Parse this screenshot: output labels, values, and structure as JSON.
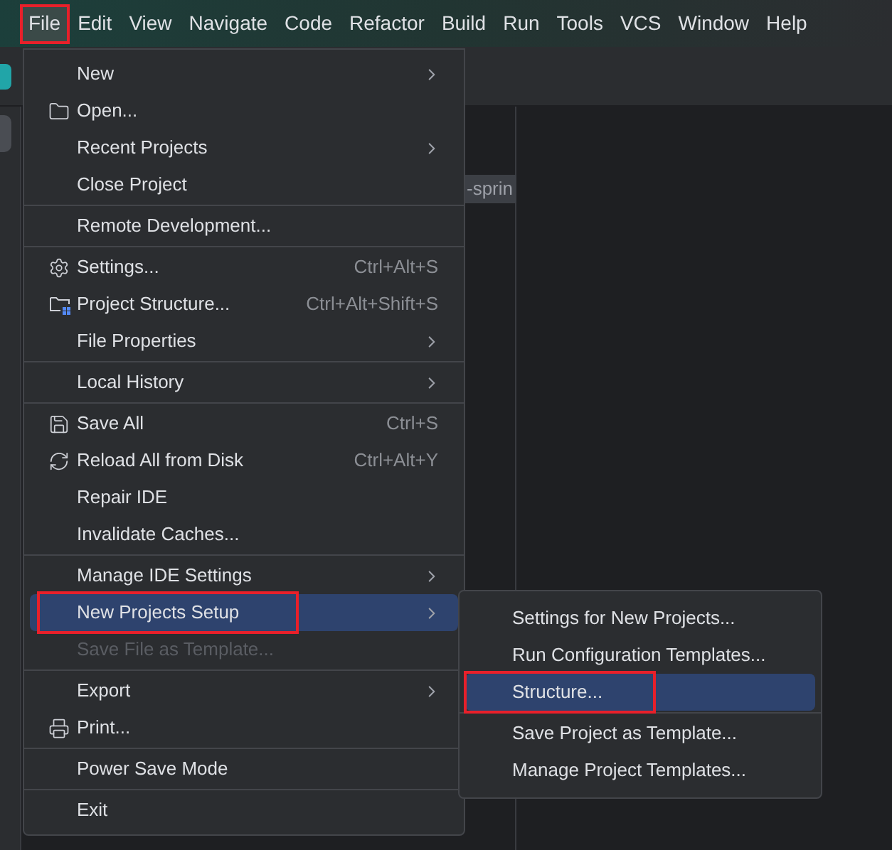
{
  "menu_bar": [
    {
      "label": "File",
      "selected": true,
      "annotated": true
    },
    {
      "label": "Edit",
      "selected": false,
      "annotated": false
    },
    {
      "label": "View",
      "selected": false,
      "annotated": false
    },
    {
      "label": "Navigate",
      "selected": false,
      "annotated": false
    },
    {
      "label": "Code",
      "selected": false,
      "annotated": false
    },
    {
      "label": "Refactor",
      "selected": false,
      "annotated": false
    },
    {
      "label": "Build",
      "selected": false,
      "annotated": false
    },
    {
      "label": "Run",
      "selected": false,
      "annotated": false
    },
    {
      "label": "Tools",
      "selected": false,
      "annotated": false
    },
    {
      "label": "VCS",
      "selected": false,
      "annotated": false
    },
    {
      "label": "Window",
      "selected": false,
      "annotated": false
    },
    {
      "label": "Help",
      "selected": false,
      "annotated": false
    }
  ],
  "editor": {
    "tab_fragment": "-sprin"
  },
  "file_menu": {
    "items": [
      {
        "kind": "item",
        "label": "New",
        "submenu": true,
        "selected": false,
        "disabled": false,
        "annotated": false
      },
      {
        "kind": "item",
        "label": "Open...",
        "submenu": false,
        "selected": false,
        "disabled": false,
        "annotated": false
      },
      {
        "kind": "item",
        "label": "Recent Projects",
        "submenu": true,
        "selected": false,
        "disabled": false,
        "annotated": false
      },
      {
        "kind": "item",
        "label": "Close Project",
        "submenu": false,
        "selected": false,
        "disabled": false,
        "annotated": false
      },
      {
        "kind": "separator"
      },
      {
        "kind": "item",
        "label": "Remote Development...",
        "submenu": false,
        "selected": false,
        "disabled": false,
        "annotated": false
      },
      {
        "kind": "separator"
      },
      {
        "kind": "item",
        "label": "Settings...",
        "shortcut": "Ctrl+Alt+S",
        "submenu": false,
        "selected": false,
        "disabled": false,
        "annotated": false
      },
      {
        "kind": "item",
        "label": "Project Structure...",
        "shortcut": "Ctrl+Alt+Shift+S",
        "submenu": false,
        "selected": false,
        "disabled": false,
        "annotated": false
      },
      {
        "kind": "item",
        "label": "File Properties",
        "submenu": true,
        "selected": false,
        "disabled": false,
        "annotated": false
      },
      {
        "kind": "separator"
      },
      {
        "kind": "item",
        "label": "Local History",
        "submenu": true,
        "selected": false,
        "disabled": false,
        "annotated": false
      },
      {
        "kind": "separator"
      },
      {
        "kind": "item",
        "label": "Save All",
        "shortcut": "Ctrl+S",
        "submenu": false,
        "selected": false,
        "disabled": false,
        "annotated": false
      },
      {
        "kind": "item",
        "label": "Reload All from Disk",
        "shortcut": "Ctrl+Alt+Y",
        "submenu": false,
        "selected": false,
        "disabled": false,
        "annotated": false
      },
      {
        "kind": "item",
        "label": "Repair IDE",
        "submenu": false,
        "selected": false,
        "disabled": false,
        "annotated": false
      },
      {
        "kind": "item",
        "label": "Invalidate Caches...",
        "submenu": false,
        "selected": false,
        "disabled": false,
        "annotated": false
      },
      {
        "kind": "separator"
      },
      {
        "kind": "item",
        "label": "Manage IDE Settings",
        "submenu": true,
        "selected": false,
        "disabled": false,
        "annotated": false
      },
      {
        "kind": "item",
        "label": "New Projects Setup",
        "submenu": true,
        "selected": true,
        "disabled": false,
        "annotated": true
      },
      {
        "kind": "item",
        "label": "Save File as Template...",
        "submenu": false,
        "selected": false,
        "disabled": true,
        "annotated": false
      },
      {
        "kind": "separator"
      },
      {
        "kind": "item",
        "label": "Export",
        "submenu": true,
        "selected": false,
        "disabled": false,
        "annotated": false
      },
      {
        "kind": "item",
        "label": "Print...",
        "submenu": false,
        "selected": false,
        "disabled": false,
        "annotated": false
      },
      {
        "kind": "separator"
      },
      {
        "kind": "item",
        "label": "Power Save Mode",
        "submenu": false,
        "selected": false,
        "disabled": false,
        "annotated": false
      },
      {
        "kind": "separator"
      },
      {
        "kind": "item",
        "label": "Exit",
        "submenu": false,
        "selected": false,
        "disabled": false,
        "annotated": false
      }
    ]
  },
  "submenu": {
    "items": [
      {
        "kind": "item",
        "label": "Settings for New Projects...",
        "submenu": false,
        "selected": false,
        "disabled": false,
        "annotated": false
      },
      {
        "kind": "item",
        "label": "Run Configuration Templates...",
        "submenu": false,
        "selected": false,
        "disabled": false,
        "annotated": false
      },
      {
        "kind": "item",
        "label": "Structure...",
        "submenu": false,
        "selected": true,
        "disabled": false,
        "annotated": true
      },
      {
        "kind": "separator"
      },
      {
        "kind": "item",
        "label": "Save Project as Template...",
        "submenu": false,
        "selected": false,
        "disabled": false,
        "annotated": false
      },
      {
        "kind": "item",
        "label": "Manage Project Templates...",
        "submenu": false,
        "selected": false,
        "disabled": false,
        "annotated": false
      }
    ]
  }
}
